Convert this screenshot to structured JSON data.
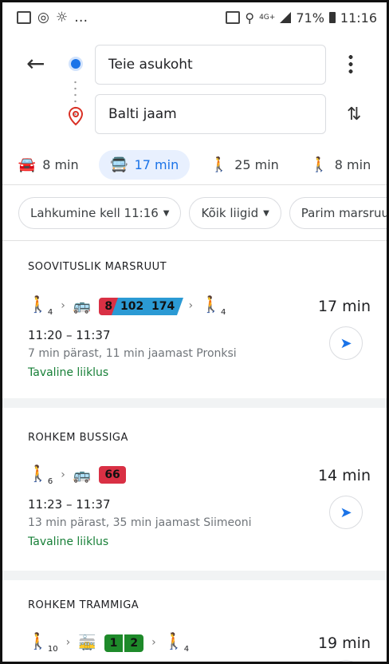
{
  "status_bar": {
    "battery": "71%",
    "time": "11:16",
    "network": "4G+",
    "left_icons": [
      "gallery-icon",
      "instagram-icon",
      "weather-icon",
      "more-icon"
    ],
    "right_icons": [
      "battery-saver-icon",
      "location-icon",
      "signal-icon",
      "battery-icon"
    ]
  },
  "directions": {
    "origin": "Teie asukoht",
    "destination": "Balti jaam"
  },
  "modes": [
    {
      "icon": "car-icon",
      "label": "8 min"
    },
    {
      "icon": "transit-icon",
      "label": "17 min",
      "active": true
    },
    {
      "icon": "walk-icon",
      "label": "25 min"
    },
    {
      "icon": "ride-icon",
      "label": "8 min"
    }
  ],
  "chips": [
    "Lahkumine kell 11:16",
    "Kõik liigid",
    "Parim marsruut"
  ],
  "routes": [
    {
      "heading": "SOOVITUSLIK MARSRUUT",
      "walk_start": "4",
      "lines": [
        "8",
        "102",
        "174"
      ],
      "walk_end": "4",
      "duration": "17 min",
      "times": "11:20 – 11:37",
      "description": "7 min pärast, 11 min jaamast Pronksi",
      "traffic": "Tavaline liiklus"
    },
    {
      "heading": "ROHKEM BUSSIGA",
      "walk_start": "6",
      "lines": [
        "66"
      ],
      "duration": "14 min",
      "times": "11:23 – 11:37",
      "description": "13 min pärast, 35 min jaamast Siimeoni",
      "traffic": "Tavaline liiklus"
    },
    {
      "heading": "ROHKEM TRAMMIGA",
      "walk_start": "10",
      "lines": [
        "1",
        "2"
      ],
      "walk_end": "4",
      "duration": "19 min"
    }
  ],
  "colors": {
    "accent": "#1a73e8",
    "bus_red": "#d93044",
    "bus_blue": "#2b9ad4",
    "tram_green": "#1e8a2a",
    "traffic_green": "#188038"
  }
}
